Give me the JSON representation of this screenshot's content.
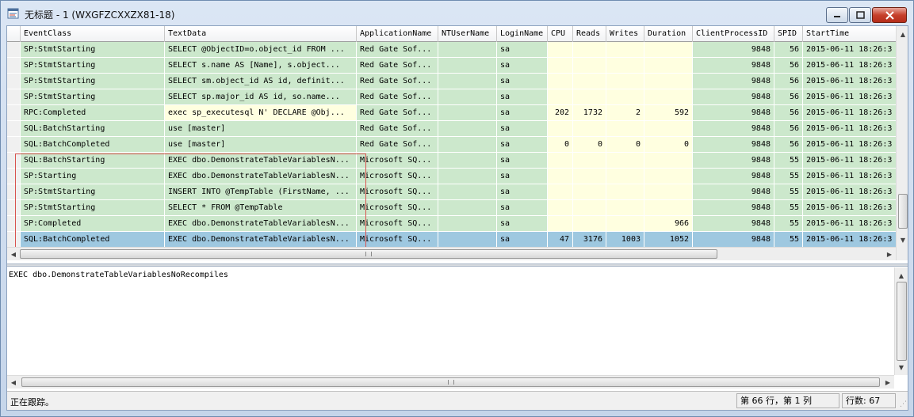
{
  "window": {
    "title": "无标题 - 1 (WXGFZCXXZX81-18)"
  },
  "grid": {
    "columns": [
      "EventClass",
      "TextData",
      "ApplicationName",
      "NTUserName",
      "LoginName",
      "CPU",
      "Reads",
      "Writes",
      "Duration",
      "ClientProcessID",
      "SPID",
      "StartTime"
    ],
    "rows": [
      {
        "EventClass": "SP:StmtStarting",
        "TextData": "SELECT @ObjectID=o.object_id  FROM ...",
        "ApplicationName": "Red Gate Sof...",
        "NTUserName": "",
        "LoginName": "sa",
        "CPU": "",
        "Reads": "",
        "Writes": "",
        "Duration": "",
        "ClientProcessID": "9848",
        "SPID": "56",
        "StartTime": "2015-06-11 18:26:3"
      },
      {
        "EventClass": "SP:StmtStarting",
        "TextData": "SELECT s.name AS [Name],    s.object...",
        "ApplicationName": "Red Gate Sof...",
        "NTUserName": "",
        "LoginName": "sa",
        "CPU": "",
        "Reads": "",
        "Writes": "",
        "Duration": "",
        "ClientProcessID": "9848",
        "SPID": "56",
        "StartTime": "2015-06-11 18:26:3"
      },
      {
        "EventClass": "SP:StmtStarting",
        "TextData": "SELECT sm.object_id AS id,   definit...",
        "ApplicationName": "Red Gate Sof...",
        "NTUserName": "",
        "LoginName": "sa",
        "CPU": "",
        "Reads": "",
        "Writes": "",
        "Duration": "",
        "ClientProcessID": "9848",
        "SPID": "56",
        "StartTime": "2015-06-11 18:26:3"
      },
      {
        "EventClass": "SP:StmtStarting",
        "TextData": "SELECT sp.major_id AS id,    so.name...",
        "ApplicationName": "Red Gate Sof...",
        "NTUserName": "",
        "LoginName": "sa",
        "CPU": "",
        "Reads": "",
        "Writes": "",
        "Duration": "",
        "ClientProcessID": "9848",
        "SPID": "56",
        "StartTime": "2015-06-11 18:26:3"
      },
      {
        "EventClass": "RPC:Completed",
        "TextData": "exec sp_executesql N'   DECLARE @Obj...",
        "ApplicationName": "Red Gate Sof...",
        "NTUserName": "",
        "LoginName": "sa",
        "CPU": "202",
        "Reads": "1732",
        "Writes": "2",
        "Duration": "592",
        "ClientProcessID": "9848",
        "SPID": "56",
        "StartTime": "2015-06-11 18:26:3"
      },
      {
        "EventClass": "SQL:BatchStarting",
        "TextData": "use [master]",
        "ApplicationName": "Red Gate Sof...",
        "NTUserName": "",
        "LoginName": "sa",
        "CPU": "",
        "Reads": "",
        "Writes": "",
        "Duration": "",
        "ClientProcessID": "9848",
        "SPID": "56",
        "StartTime": "2015-06-11 18:26:3"
      },
      {
        "EventClass": "SQL:BatchCompleted",
        "TextData": "use [master]",
        "ApplicationName": "Red Gate Sof...",
        "NTUserName": "",
        "LoginName": "sa",
        "CPU": "0",
        "Reads": "0",
        "Writes": "0",
        "Duration": "0",
        "ClientProcessID": "9848",
        "SPID": "56",
        "StartTime": "2015-06-11 18:26:3"
      },
      {
        "EventClass": "SQL:BatchStarting",
        "TextData": "EXEC dbo.DemonstrateTableVariablesN...",
        "ApplicationName": "Microsoft SQ...",
        "NTUserName": "",
        "LoginName": "sa",
        "CPU": "",
        "Reads": "",
        "Writes": "",
        "Duration": "",
        "ClientProcessID": "9848",
        "SPID": "55",
        "StartTime": "2015-06-11 18:26:3"
      },
      {
        "EventClass": "SP:Starting",
        "TextData": "EXEC dbo.DemonstrateTableVariablesN...",
        "ApplicationName": "Microsoft SQ...",
        "NTUserName": "",
        "LoginName": "sa",
        "CPU": "",
        "Reads": "",
        "Writes": "",
        "Duration": "",
        "ClientProcessID": "9848",
        "SPID": "55",
        "StartTime": "2015-06-11 18:26:3"
      },
      {
        "EventClass": "SP:StmtStarting",
        "TextData": "INSERT INTO @TempTable (FirstName, ...",
        "ApplicationName": "Microsoft SQ...",
        "NTUserName": "",
        "LoginName": "sa",
        "CPU": "",
        "Reads": "",
        "Writes": "",
        "Duration": "",
        "ClientProcessID": "9848",
        "SPID": "55",
        "StartTime": "2015-06-11 18:26:3"
      },
      {
        "EventClass": "SP:StmtStarting",
        "TextData": "SELECT * FROM @TempTable",
        "ApplicationName": "Microsoft SQ...",
        "NTUserName": "",
        "LoginName": "sa",
        "CPU": "",
        "Reads": "",
        "Writes": "",
        "Duration": "",
        "ClientProcessID": "9848",
        "SPID": "55",
        "StartTime": "2015-06-11 18:26:3"
      },
      {
        "EventClass": "SP:Completed",
        "TextData": "EXEC dbo.DemonstrateTableVariablesN...",
        "ApplicationName": "Microsoft SQ...",
        "NTUserName": "",
        "LoginName": "sa",
        "CPU": "",
        "Reads": "",
        "Writes": "",
        "Duration": "966",
        "ClientProcessID": "9848",
        "SPID": "55",
        "StartTime": "2015-06-11 18:26:3"
      },
      {
        "EventClass": "SQL:BatchCompleted",
        "TextData": "EXEC dbo.DemonstrateTableVariablesN...",
        "ApplicationName": "Microsoft SQ...",
        "NTUserName": "",
        "LoginName": "sa",
        "CPU": "47",
        "Reads": "3176",
        "Writes": "1003",
        "Duration": "1052",
        "ClientProcessID": "9848",
        "SPID": "55",
        "StartTime": "2015-06-11 18:26:3",
        "selected": true
      }
    ]
  },
  "detail": {
    "text": "EXEC dbo.DemonstrateTableVariablesNoRecompiles"
  },
  "status": {
    "message": "正在跟踪。",
    "position": "第 66 行，第 1 列",
    "row_count": "行数: 67"
  },
  "colors": {
    "row_green": "#cce8cc",
    "metric_cream": "#ffffe0",
    "selected_blue": "#9ec8e0",
    "highlight_border": "#d9534f"
  }
}
